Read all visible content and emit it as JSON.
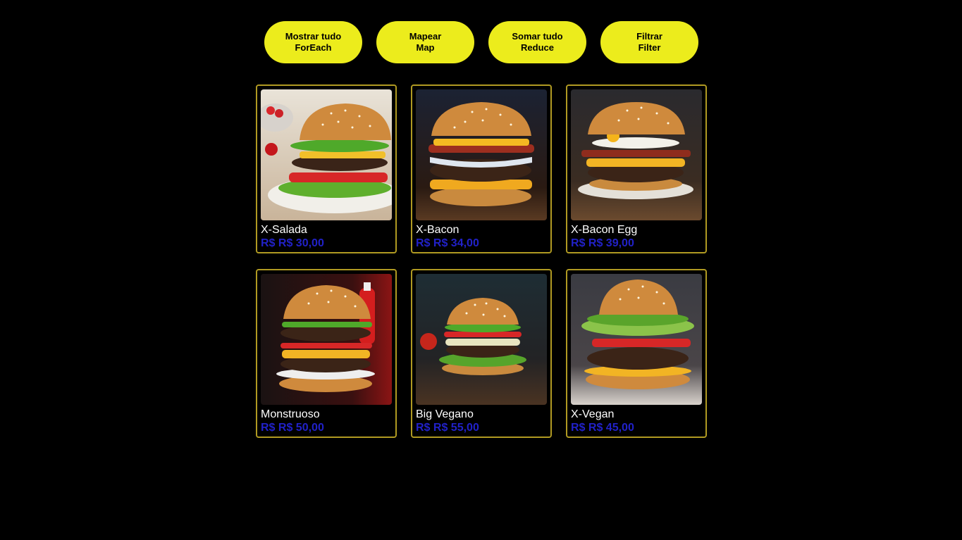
{
  "buttons": [
    {
      "line1": "Mostrar tudo",
      "line2": "ForEach"
    },
    {
      "line1": "Mapear",
      "line2": "Map"
    },
    {
      "line1": "Somar tudo",
      "line2": "Reduce"
    },
    {
      "line1": "Filtrar",
      "line2": "Filter"
    }
  ],
  "products": [
    {
      "name": "X-Salada",
      "price": "R$ R$ 30,00"
    },
    {
      "name": "X-Bacon",
      "price": "R$ R$ 34,00"
    },
    {
      "name": "X-Bacon Egg",
      "price": "R$ R$ 39,00"
    },
    {
      "name": "Monstruoso",
      "price": "R$ R$ 50,00"
    },
    {
      "name": "Big Vegano",
      "price": "R$ R$ 55,00"
    },
    {
      "name": "X-Vegan",
      "price": "R$ R$ 45,00"
    }
  ],
  "colors": {
    "background": "#000000",
    "button": "#ecec1c",
    "card_border": "#b09a22",
    "price": "#2121c8"
  }
}
